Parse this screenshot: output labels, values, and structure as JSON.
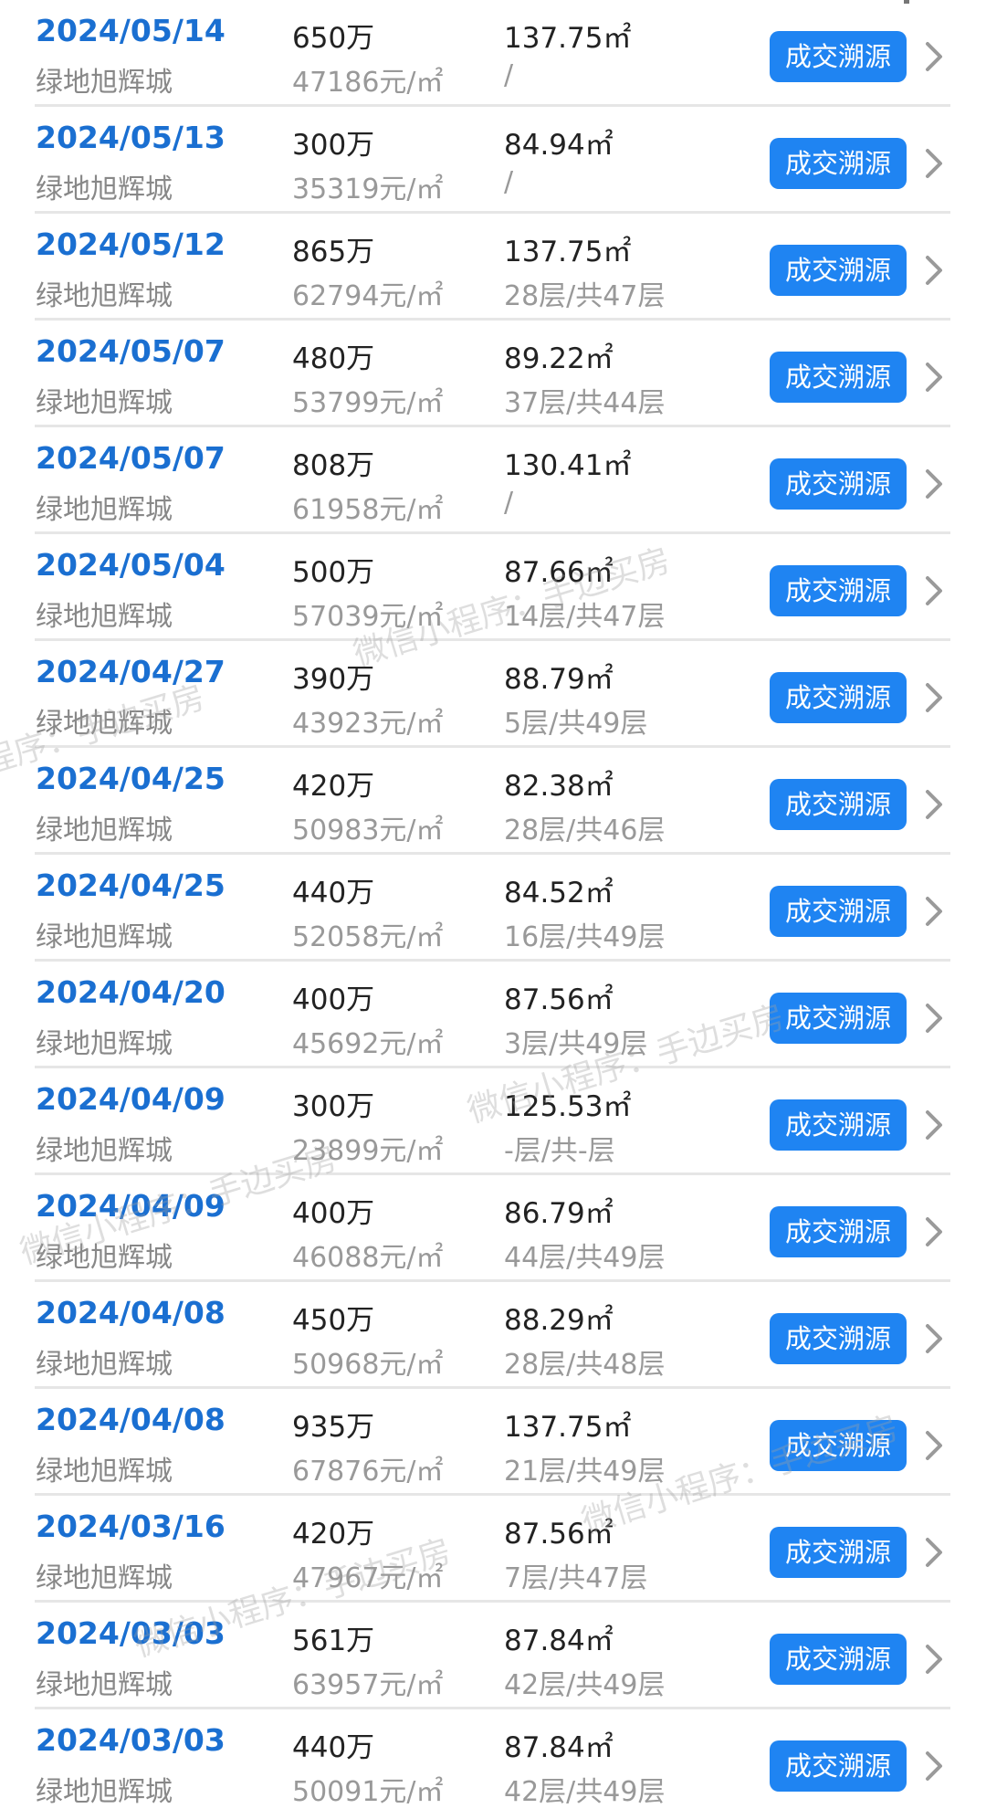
{
  "transactions": [
    {
      "date": "2024/05/14",
      "community": "绿地旭辉城",
      "price": "650万",
      "unit_price": "47186元/㎡",
      "area": "137.75㎡",
      "floor": "/",
      "button_label": "成交溯源"
    },
    {
      "date": "2024/05/13",
      "community": "绿地旭辉城",
      "price": "300万",
      "unit_price": "35319元/㎡",
      "area": "84.94㎡",
      "floor": "/",
      "button_label": "成交溯源"
    },
    {
      "date": "2024/05/12",
      "community": "绿地旭辉城",
      "price": "865万",
      "unit_price": "62794元/㎡",
      "area": "137.75㎡",
      "floor": "28层/共47层",
      "button_label": "成交溯源"
    },
    {
      "date": "2024/05/07",
      "community": "绿地旭辉城",
      "price": "480万",
      "unit_price": "53799元/㎡",
      "area": "89.22㎡",
      "floor": "37层/共44层",
      "button_label": "成交溯源"
    },
    {
      "date": "2024/05/07",
      "community": "绿地旭辉城",
      "price": "808万",
      "unit_price": "61958元/㎡",
      "area": "130.41㎡",
      "floor": "/",
      "button_label": "成交溯源"
    },
    {
      "date": "2024/05/04",
      "community": "绿地旭辉城",
      "price": "500万",
      "unit_price": "57039元/㎡",
      "area": "87.66㎡",
      "floor": "14层/共47层",
      "button_label": "成交溯源"
    },
    {
      "date": "2024/04/27",
      "community": "绿地旭辉城",
      "price": "390万",
      "unit_price": "43923元/㎡",
      "area": "88.79㎡",
      "floor": "5层/共49层",
      "button_label": "成交溯源"
    },
    {
      "date": "2024/04/25",
      "community": "绿地旭辉城",
      "price": "420万",
      "unit_price": "50983元/㎡",
      "area": "82.38㎡",
      "floor": "28层/共46层",
      "button_label": "成交溯源"
    },
    {
      "date": "2024/04/25",
      "community": "绿地旭辉城",
      "price": "440万",
      "unit_price": "52058元/㎡",
      "area": "84.52㎡",
      "floor": "16层/共49层",
      "button_label": "成交溯源"
    },
    {
      "date": "2024/04/20",
      "community": "绿地旭辉城",
      "price": "400万",
      "unit_price": "45692元/㎡",
      "area": "87.56㎡",
      "floor": "3层/共49层",
      "button_label": "成交溯源"
    },
    {
      "date": "2024/04/09",
      "community": "绿地旭辉城",
      "price": "300万",
      "unit_price": "23899元/㎡",
      "area": "125.53㎡",
      "floor": "-层/共-层",
      "button_label": "成交溯源"
    },
    {
      "date": "2024/04/09",
      "community": "绿地旭辉城",
      "price": "400万",
      "unit_price": "46088元/㎡",
      "area": "86.79㎡",
      "floor": "44层/共49层",
      "button_label": "成交溯源"
    },
    {
      "date": "2024/04/08",
      "community": "绿地旭辉城",
      "price": "450万",
      "unit_price": "50968元/㎡",
      "area": "88.29㎡",
      "floor": "28层/共48层",
      "button_label": "成交溯源"
    },
    {
      "date": "2024/04/08",
      "community": "绿地旭辉城",
      "price": "935万",
      "unit_price": "67876元/㎡",
      "area": "137.75㎡",
      "floor": "21层/共49层",
      "button_label": "成交溯源"
    },
    {
      "date": "2024/03/16",
      "community": "绿地旭辉城",
      "price": "420万",
      "unit_price": "47967元/㎡",
      "area": "87.56㎡",
      "floor": "7层/共47层",
      "button_label": "成交溯源"
    },
    {
      "date": "2024/03/03",
      "community": "绿地旭辉城",
      "price": "561万",
      "unit_price": "63957元/㎡",
      "area": "87.84㎡",
      "floor": "42层/共49层",
      "button_label": "成交溯源"
    },
    {
      "date": "2024/03/03",
      "community": "绿地旭辉城",
      "price": "440万",
      "unit_price": "50091元/㎡",
      "area": "87.84㎡",
      "floor": "42层/共49层",
      "button_label": "成交溯源"
    }
  ],
  "watermark": {
    "text": "微信小程序：手边买房",
    "color": "#a0a0a0"
  },
  "colors": {
    "date": "#1a6fd1",
    "button_bg": "#1f84f2",
    "button_text": "#ffffff",
    "secondary_text": "#999999",
    "divider": "#e6e6e6"
  },
  "icons": {
    "row_chevron": "chevron-right-icon"
  }
}
